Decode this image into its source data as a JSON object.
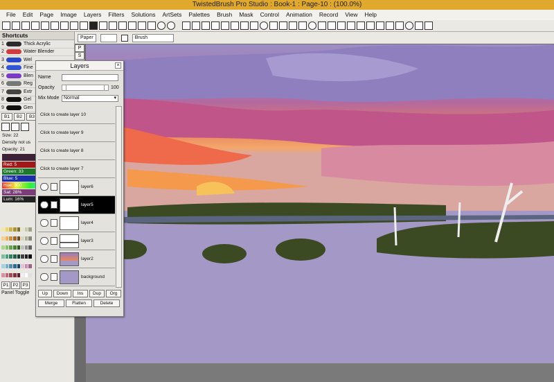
{
  "window_title": "TwistedBrush Pro Studio : Book-1 : Page-10 : (100.0%)",
  "menu": [
    "File",
    "Edit",
    "Page",
    "Image",
    "Layers",
    "Filters",
    "Solutions",
    "ArtSets",
    "Palettes",
    "Brush",
    "Mask",
    "Control",
    "Animation",
    "Record",
    "View",
    "Help"
  ],
  "propbar": {
    "paper_label": "Paper",
    "brush_label": "Brush"
  },
  "shortcuts": {
    "header": "Shortcuts",
    "brushes": [
      {
        "num": "1",
        "name": "Thick Acrylic",
        "color": "#2b2b2b"
      },
      {
        "num": "2",
        "name": "Water Blender",
        "color": "#d23c3c"
      },
      {
        "num": "3",
        "name": "Wel",
        "color": "#2748c8"
      },
      {
        "num": "4",
        "name": "Fine",
        "color": "#3056d8"
      },
      {
        "num": "5",
        "name": "Blen",
        "color": "#7a3cc4"
      },
      {
        "num": "6",
        "name": "Reg",
        "color": "#777777"
      },
      {
        "num": "7",
        "name": "Extr",
        "color": "#444444"
      },
      {
        "num": "8",
        "name": "Gel",
        "color": "#111111"
      },
      {
        "num": "9",
        "name": "Gen",
        "color": "#111111"
      }
    ],
    "banks": [
      "B1",
      "B2",
      "B3"
    ],
    "size_label": "Size: 22",
    "density_label": "Density not us",
    "opacity_label": "Opacity: 21",
    "red_label": "Red: 5",
    "green_label": "Green: 33",
    "blue_label": "Blue: 5",
    "hue_label": "Hue: 300",
    "sat_label": "Sat: 28%",
    "lum_label": "Lum: 16%",
    "pages": [
      "P1",
      "P2",
      "P3"
    ],
    "panel_toggle_label": "Panel Toggle"
  },
  "layers_panel": {
    "title": "Layers",
    "name_label": "Name",
    "name_value": "",
    "opacity_label": "Opacity",
    "opacity_value": "100",
    "mixmode_label": "Mix Mode",
    "mixmode_value": "Normal",
    "empty_slots": [
      "Click to create layer 10",
      "Click to create layer 9",
      "Click to create layer 8",
      "Click to create layer 7"
    ],
    "layers": [
      {
        "name": "layer6",
        "selected": false
      },
      {
        "name": "layer5",
        "selected": true
      },
      {
        "name": "layer4",
        "selected": false
      },
      {
        "name": "layer3",
        "selected": false
      },
      {
        "name": "layer2",
        "selected": false
      },
      {
        "name": "background",
        "selected": false
      }
    ],
    "buttons_row1": [
      "Up",
      "Down",
      "Ins",
      "Dup",
      "Org"
    ],
    "buttons_row2": [
      "Merge",
      "Flatten",
      "Delete"
    ]
  },
  "colors": {
    "title_bar": "#e0a92d",
    "selected_layer": "#000000",
    "sky": "#a398c6"
  }
}
